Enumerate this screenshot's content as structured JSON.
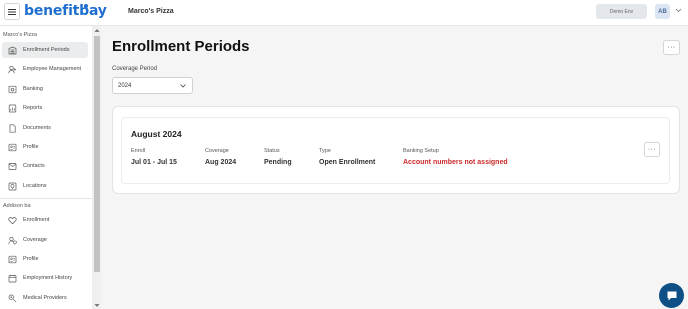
{
  "header": {
    "logo_text": "benefitbay",
    "company_name": "Marco's Pizza",
    "env_button": "Demo Env",
    "avatar_initials": "AB"
  },
  "sidebar": {
    "company_section": "Marco's Pizza",
    "company_items": [
      {
        "label": "Enrollment Periods",
        "icon": "building-icon",
        "active": true
      },
      {
        "label": "Employee Management",
        "icon": "person-plus-icon",
        "active": false
      },
      {
        "label": "Banking",
        "icon": "bank-icon",
        "active": false
      },
      {
        "label": "Reports",
        "icon": "report-icon",
        "active": false
      },
      {
        "label": "Documents",
        "icon": "document-icon",
        "active": false
      },
      {
        "label": "Profile",
        "icon": "profile-card-icon",
        "active": false
      },
      {
        "label": "Contacts",
        "icon": "contacts-icon",
        "active": false
      },
      {
        "label": "Locations",
        "icon": "location-icon",
        "active": false
      }
    ],
    "user_section": "Addison ba",
    "user_items": [
      {
        "label": "Enrollment",
        "icon": "heart-icon"
      },
      {
        "label": "Coverage",
        "icon": "person-shield-icon"
      },
      {
        "label": "Profile",
        "icon": "profile-card-icon"
      },
      {
        "label": "Employment History",
        "icon": "calendar-icon"
      },
      {
        "label": "Medical Providers",
        "icon": "medical-icon"
      }
    ]
  },
  "main": {
    "title": "Enrollment Periods",
    "more_label": "···",
    "coverage_period_label": "Coverage Period",
    "coverage_period_value": "2024",
    "period": {
      "title": "August 2024",
      "enroll_label": "Enroll",
      "enroll_value": "Jul 01 - Jul 15",
      "coverage_label": "Coverage",
      "coverage_value": "Aug 2024",
      "status_label": "Status",
      "status_value": "Pending",
      "type_label": "Type",
      "type_value": "Open Enrollment",
      "banking_label": "Banking Setup",
      "banking_value": "Account numbers not assigned"
    }
  },
  "colors": {
    "brand": "#1f6fd1",
    "warning": "#cc2a2a",
    "chat": "#0e4f86"
  }
}
